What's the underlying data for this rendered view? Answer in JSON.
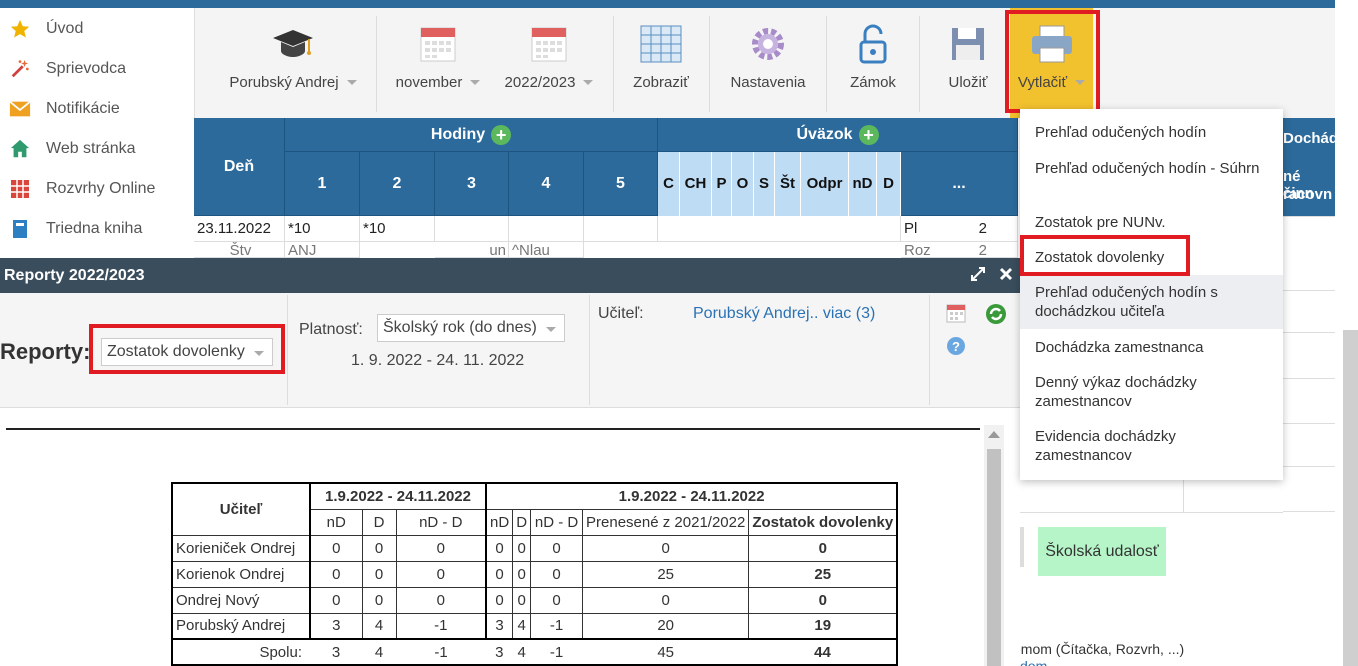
{
  "sidebar": {
    "items": [
      {
        "label": "Úvod",
        "icon": "star-icon",
        "color": "#f0b400"
      },
      {
        "label": "Sprievodca",
        "icon": "magic-wand-icon",
        "color": "#e04040"
      },
      {
        "label": "Notifikácie",
        "icon": "envelope-icon",
        "color": "#f0a020"
      },
      {
        "label": "Web stránka",
        "icon": "home-icon",
        "color": "#2e9a6e"
      },
      {
        "label": "Rozvrhy Online",
        "icon": "timetable-icon",
        "color": "#d9473c"
      },
      {
        "label": "Triedna kniha",
        "icon": "book-icon",
        "color": "#2e7fc1"
      }
    ]
  },
  "toolbar": {
    "teacher": "Porubský Andrej",
    "month": "november",
    "year": "2022/2023",
    "show": "Zobraziť",
    "settings": "Nastavenia",
    "lock": "Zámok",
    "save": "Uložiť",
    "print": "Vytlačiť"
  },
  "grid": {
    "den": "Deň",
    "hodiny": "Hodiny",
    "uvazok": "Úväzok",
    "plus": "+",
    "hour_cols": [
      "1",
      "2",
      "3",
      "4",
      "5"
    ],
    "uvazok_cols": [
      "C",
      "CH",
      "P",
      "O",
      "S",
      "Št",
      "Odpr",
      "nD",
      "D",
      "..."
    ],
    "row1": {
      "date": "23.11.2022",
      "h1": "*10",
      "h2": "*10",
      "code": "Pl",
      "num": "2"
    },
    "row2": {
      "day": "Štv",
      "h1": "ANJ",
      "h3": "un",
      "h4": "^Nlau",
      "code": "Roz",
      "num": "2"
    }
  },
  "behind": {
    "doch": "Dochádz",
    "line1": "né činn",
    "line2": "racovn",
    "event": "Školská udalosť",
    "bottom": "émom (Čítačka, Rozvrh, ...)",
    "bottom2": "dom"
  },
  "menu": {
    "items": [
      "Prehľad odučených hodín",
      "Prehľad odučených hodín - Súhrn",
      "Zostatok pre NUNv.",
      "Zostatok dovolenky",
      "Prehľad odučených hodín s dochádzkou učiteľa",
      "Dochádzka zamestnanca",
      "Denný výkaz dochádzky zamestnancov",
      "Evidencia dochádzky zamestnancov"
    ]
  },
  "dialog": {
    "title": "Reporty 2022/2023",
    "reporty_label": "Reporty:",
    "report_selected": "Zostatok dovolenky",
    "platnost_label": "Platnosť:",
    "platnost_value": "Školský rok (do dnes)",
    "date_range": "1. 9. 2022 - 24. 11. 2022",
    "ucitel_label": "Učiteľ:",
    "ucitel_value": "Porubský Andrej.. viac (3)"
  },
  "report": {
    "col_teacher": "Učiteľ",
    "period1": "1.9.2022 - 24.11.2022",
    "period2": "1.9.2022 - 24.11.2022",
    "sub1": [
      "nD",
      "D",
      "nD - D"
    ],
    "sub2": [
      "nD",
      "D",
      "nD - D",
      "Prenesené z 2021/2022",
      "Zostatok dovolenky"
    ],
    "rows": [
      {
        "name": "Korieniček Ondrej",
        "v": [
          "0",
          "0",
          "0",
          "0",
          "0",
          "0",
          "0",
          "0"
        ]
      },
      {
        "name": "Korienok Ondrej",
        "v": [
          "0",
          "0",
          "0",
          "0",
          "0",
          "0",
          "25",
          "25"
        ]
      },
      {
        "name": "Ondrej Nový",
        "v": [
          "0",
          "0",
          "0",
          "0",
          "0",
          "0",
          "0",
          "0"
        ]
      },
      {
        "name": "Porubský Andrej",
        "v": [
          "3",
          "4",
          "-1",
          "3",
          "4",
          "-1",
          "20",
          "19"
        ]
      }
    ],
    "total": {
      "name": "Spolu:",
      "v": [
        "3",
        "4",
        "-1",
        "3",
        "4",
        "-1",
        "45",
        "44"
      ]
    }
  }
}
